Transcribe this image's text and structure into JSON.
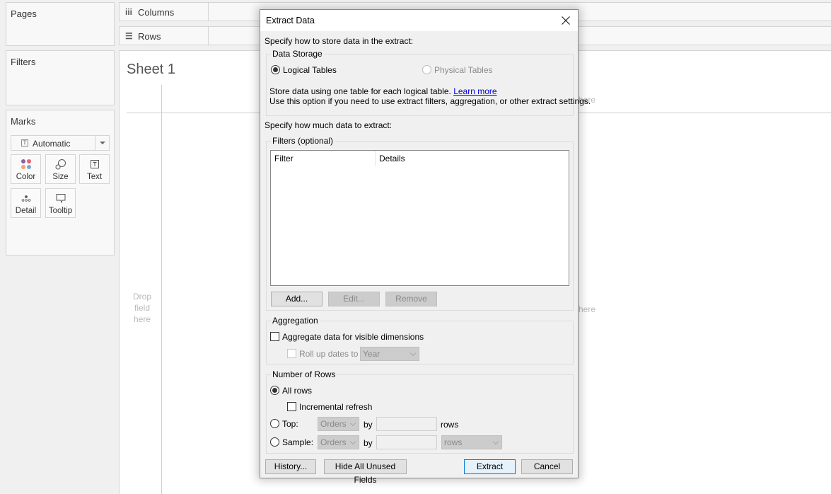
{
  "left_panel": {
    "pages_title": "Pages",
    "filters_title": "Filters",
    "marks": {
      "title": "Marks",
      "mark_type": "Automatic",
      "buttons": [
        {
          "label": "Color",
          "icon": "color-icon"
        },
        {
          "label": "Size",
          "icon": "size-icon"
        },
        {
          "label": "Text",
          "icon": "text-icon"
        },
        {
          "label": "Detail",
          "icon": "detail-icon"
        },
        {
          "label": "Tooltip",
          "icon": "tooltip-icon"
        }
      ],
      "color_dots": [
        "#8a5f9e",
        "#e8626f",
        "#f2a36e",
        "#7ea6d5"
      ]
    }
  },
  "shelves": {
    "columns_icon": "iii",
    "columns_label": "Columns",
    "rows_icon": "☰",
    "rows_label": "Rows"
  },
  "sheet": {
    "title": "Sheet 1",
    "drop_rows_hint": "Drop field here",
    "drop_cols_hint": "here",
    "drop_mid_hint": "here"
  },
  "dialog": {
    "title": "Extract Data",
    "close_icon": "✕",
    "store_prompt": "Specify how to store data in the extract:",
    "data_storage": {
      "legend": "Data Storage",
      "options": [
        {
          "label": "Logical Tables",
          "checked": true,
          "enabled": true
        },
        {
          "label": "Physical Tables",
          "checked": false,
          "enabled": false
        }
      ],
      "description_line1": "Store data using one table for each logical table.",
      "learn_more": "Learn more",
      "description_line2": "Use this option if you need to use extract filters, aggregation, or other extract settings."
    },
    "amount_prompt": "Specify how much data to extract:",
    "filters": {
      "legend": "Filters (optional)",
      "columns": [
        "Filter",
        "Details"
      ],
      "rows": [],
      "add_label": "Add...",
      "edit_label": "Edit...",
      "remove_label": "Remove"
    },
    "aggregation": {
      "legend": "Aggregation",
      "aggregate_label": "Aggregate data for visible dimensions",
      "aggregate_checked": false,
      "rollup_label": "Roll up dates to",
      "rollup_checked": false,
      "rollup_value": "Year"
    },
    "number_of_rows": {
      "legend": "Number of Rows",
      "all_rows_label": "All rows",
      "all_rows_checked": true,
      "incremental_label": "Incremental refresh",
      "incremental_checked": false,
      "top_label": "Top:",
      "top_table": "Orders",
      "top_by": "by",
      "top_value": "",
      "top_unit": "rows",
      "sample_label": "Sample:",
      "sample_table": "Orders",
      "sample_by": "by",
      "sample_value": "",
      "sample_unit": "rows"
    },
    "footer": {
      "history_label": "History...",
      "hide_unused_label": "Hide All Unused Fields",
      "extract_label": "Extract",
      "cancel_label": "Cancel"
    }
  }
}
